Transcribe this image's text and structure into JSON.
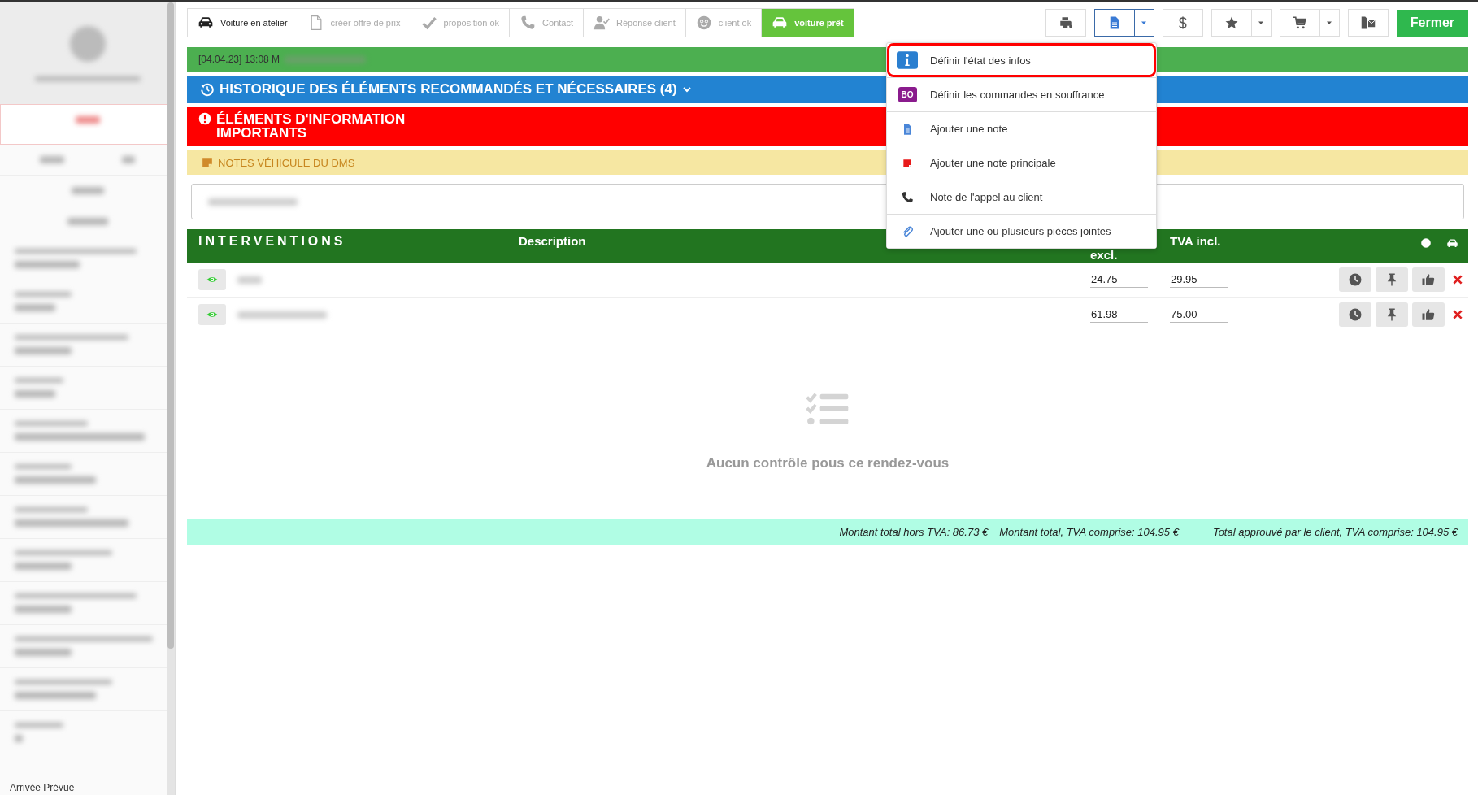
{
  "sidebar": {
    "footer_label": "Arrivée Prévue"
  },
  "stepper": [
    {
      "label": "Voiture en atelier",
      "selected": false,
      "disabled": false
    },
    {
      "label": "créer offre de prix",
      "selected": false,
      "disabled": true
    },
    {
      "label": "proposition ok",
      "selected": false,
      "disabled": true
    },
    {
      "label": "Contact",
      "selected": false,
      "disabled": true
    },
    {
      "label": "Réponse client",
      "selected": false,
      "disabled": true
    },
    {
      "label": "client ok",
      "selected": false,
      "disabled": true
    },
    {
      "label": "voiture prêt",
      "selected": true,
      "disabled": false
    }
  ],
  "toolbar": [
    {
      "dropdown": false,
      "open": false
    },
    {
      "dropdown": true,
      "open": true
    },
    {
      "dropdown": false,
      "open": false
    },
    {
      "dropdown": true,
      "open": false
    },
    {
      "dropdown": true,
      "open": false
    },
    {
      "dropdown": false,
      "open": false
    }
  ],
  "close_button": "Fermer",
  "info_bar": {
    "text": "[04.04.23] 13:08 M"
  },
  "history_bar": {
    "title": "HISTORIQUE DES ÉLÉMENTS RECOMMANDÉS ET NÉCESSAIRES (4)"
  },
  "important_bar": {
    "lines": [
      "ÉLÉMENTS D'INFORMATION",
      "IMPORTANTS"
    ]
  },
  "dms_notes": {
    "title": "NOTES VÉHICULE DU DMS"
  },
  "table": {
    "columns": [
      "INTERVENTIONS",
      "Description",
      "excl.",
      "TVA incl."
    ],
    "rows": [
      {
        "price_excl": "24.75",
        "price_incl": "29.95"
      },
      {
        "price_excl": "61.98",
        "price_incl": "75.00"
      }
    ]
  },
  "empty_state": {
    "message": "Aucun contrôle pous ce rendez-vous"
  },
  "totals": [
    "Montant total hors TVA: 86.73 €",
    "Montant total, TVA comprise: 104.95 €",
    "Total approuvé par le client, TVA comprise: 104.95 €"
  ],
  "menu": {
    "items": [
      {
        "label": "Définir l'état des infos",
        "selected": true
      },
      {
        "label": "Définir les commandes en souffrance",
        "badge": "BO",
        "selected": false
      },
      {
        "label": "Ajouter une note",
        "selected": false
      },
      {
        "label": "Ajouter une note principale",
        "selected": false
      },
      {
        "label": "Note de l'appel au client",
        "selected": false
      },
      {
        "label": "Ajouter une ou plusieurs pièces jointes",
        "selected": false
      }
    ]
  }
}
